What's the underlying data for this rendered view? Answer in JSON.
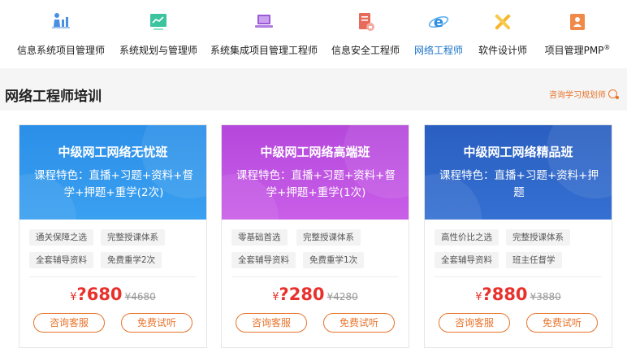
{
  "nav": {
    "items": [
      {
        "label": "信息系统项目管理师",
        "icon": "chart-person-icon"
      },
      {
        "label": "系统规划与管理师",
        "icon": "monitor-chart-icon"
      },
      {
        "label": "系统集成项目管理工程师",
        "icon": "laptop-icon"
      },
      {
        "label": "信息安全工程师",
        "icon": "shield-doc-icon"
      },
      {
        "label": "网络工程师",
        "icon": "browser-e-icon"
      },
      {
        "label": "软件设计师",
        "icon": "tools-cross-icon"
      },
      {
        "label": "项目管理PMP",
        "sup": "®",
        "icon": "person-badge-icon"
      }
    ],
    "active_index": 4,
    "active_color": "#1a73c8"
  },
  "section": {
    "title": "网络工程师培训",
    "consult_label": "咨询学习规划师"
  },
  "cards": [
    {
      "title": "中级网工网络无忧班",
      "desc": "课程特色：直播+习题+资料+督学+押题+重学(2次)",
      "tags": [
        "通关保障之选",
        "完整授课体系",
        "全套辅导资料",
        "免费重学2次"
      ],
      "currency": "¥",
      "price": "?680",
      "original": "¥4680",
      "btn_consult": "咨询客服",
      "btn_trial": "免费试听",
      "color_top": "#2b8fe8",
      "color_bottom": "#3aa0f0"
    },
    {
      "title": "中级网工网络高端班",
      "desc": "课程特色：直播+习题+资料+督学+押题+重学(1次)",
      "tags": [
        "零基础首选",
        "完整授课体系",
        "全套辅导资料",
        "免费重学1次"
      ],
      "currency": "¥",
      "price": "?280",
      "original": "¥4280",
      "btn_consult": "咨询客服",
      "btn_trial": "免费试听",
      "color_top": "#b548dc",
      "color_bottom": "#c95ee8"
    },
    {
      "title": "中级网工网络精品班",
      "desc": "课程特色：直播+习题+资料+押题",
      "tags": [
        "高性价比之选",
        "完整授课体系",
        "全套辅导资料",
        "班主任督学"
      ],
      "currency": "¥",
      "price": "?880",
      "original": "¥3880",
      "btn_consult": "咨询客服",
      "btn_trial": "免费试听",
      "color_top": "#2a5fc0",
      "color_bottom": "#3470d2"
    }
  ],
  "colors": {
    "accent_orange": "#e8742c",
    "price_red": "#e8312c"
  }
}
